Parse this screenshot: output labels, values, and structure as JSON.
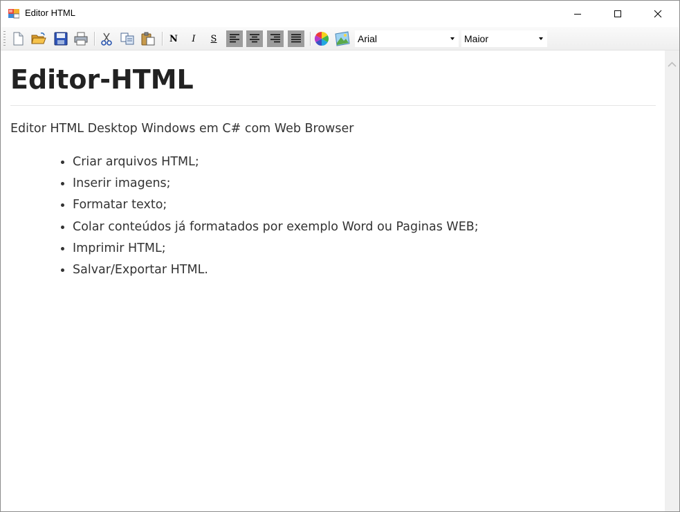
{
  "window": {
    "title": "Editor HTML",
    "icon": "app-window-icon",
    "controls": [
      "minimize-icon",
      "maximize-icon",
      "close-icon"
    ]
  },
  "toolbar": {
    "buttons": [
      {
        "name": "new-document",
        "icon": "new-document-icon"
      },
      {
        "name": "open-folder",
        "icon": "open-folder-icon"
      },
      {
        "name": "save",
        "icon": "save-floppy-icon"
      },
      {
        "name": "print",
        "icon": "printer-icon"
      },
      {
        "name": "cut",
        "icon": "scissors-icon"
      },
      {
        "name": "copy",
        "icon": "copy-icon"
      },
      {
        "name": "paste",
        "icon": "paste-clipboard-icon"
      },
      {
        "name": "bold",
        "label": "N"
      },
      {
        "name": "italic",
        "label": "I"
      },
      {
        "name": "underline",
        "label": "S"
      },
      {
        "name": "align-left",
        "icon": "align-left-icon"
      },
      {
        "name": "align-center",
        "icon": "align-center-icon"
      },
      {
        "name": "align-right",
        "icon": "align-right-icon"
      },
      {
        "name": "justify",
        "icon": "align-justify-icon"
      },
      {
        "name": "color",
        "icon": "color-wheel-icon"
      },
      {
        "name": "image",
        "icon": "insert-image-icon"
      }
    ],
    "bold_label": "N",
    "italic_label": "I",
    "underline_label": "S",
    "font_select": "Arial",
    "size_select": "Maior"
  },
  "document": {
    "heading": "Editor-HTML",
    "paragraph": "Editor HTML Desktop Windows em C# com Web Browser",
    "list": [
      "Criar arquivos HTML;",
      "Inserir imagens;",
      "Formatar texto;",
      "Colar conteúdos já formatados por exemplo Word ou Paginas WEB;",
      "Imprimir HTML;",
      "Salvar/Exportar HTML."
    ]
  },
  "colors": {
    "window_border": "#8c8c8c",
    "toolbar_bg": "#eeeeee",
    "text": "#333333",
    "heading": "#222222",
    "scrollbar": "#f0f0f0"
  }
}
